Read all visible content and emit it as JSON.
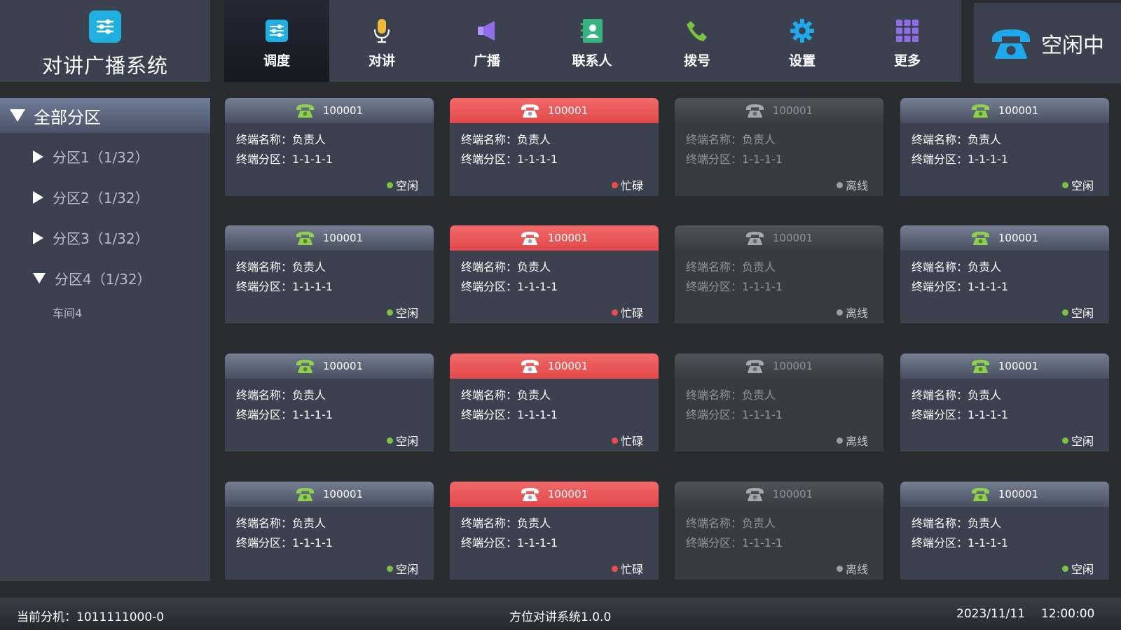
{
  "app": {
    "title": "对讲广播系统"
  },
  "nav": [
    {
      "label": "调度",
      "icon": "dispatch-icon",
      "active": true
    },
    {
      "label": "对讲",
      "icon": "microphone-icon"
    },
    {
      "label": "广播",
      "icon": "speaker-icon"
    },
    {
      "label": "联系人",
      "icon": "contacts-icon"
    },
    {
      "label": "拨号",
      "icon": "dial-phone-icon"
    },
    {
      "label": "设置",
      "icon": "gear-icon"
    },
    {
      "label": "更多",
      "icon": "grid-icon"
    }
  ],
  "status": {
    "text": "空闲中",
    "icon": "telephone-icon"
  },
  "sidebar": {
    "header": "全部分区",
    "items": [
      {
        "label": "分区1（1/32）",
        "expanded": false
      },
      {
        "label": "分区2（1/32）",
        "expanded": false
      },
      {
        "label": "分区3（1/32）",
        "expanded": false
      },
      {
        "label": "分区4（1/32）",
        "expanded": true,
        "children": [
          "车间4"
        ]
      }
    ]
  },
  "card_labels": {
    "name_prefix": "终端名称：",
    "zone_prefix": "终端分区："
  },
  "status_labels": {
    "idle": "空闲",
    "busy": "忙碌",
    "offline": "离线"
  },
  "colors": {
    "idle": "#7cc142",
    "busy": "#e24848",
    "offline": "#8f939c",
    "accent": "#1fb0e0"
  },
  "terminals": [
    {
      "id": "100001",
      "name": "负责人",
      "zone": "1-1-1-1",
      "state": "idle"
    },
    {
      "id": "100001",
      "name": "负责人",
      "zone": "1-1-1-1",
      "state": "busy"
    },
    {
      "id": "100001",
      "name": "负责人",
      "zone": "1-1-1-1",
      "state": "offline"
    },
    {
      "id": "100001",
      "name": "负责人",
      "zone": "1-1-1-1",
      "state": "idle"
    },
    {
      "id": "100001",
      "name": "负责人",
      "zone": "1-1-1-1",
      "state": "idle"
    },
    {
      "id": "100001",
      "name": "负责人",
      "zone": "1-1-1-1",
      "state": "busy"
    },
    {
      "id": "100001",
      "name": "负责人",
      "zone": "1-1-1-1",
      "state": "offline"
    },
    {
      "id": "100001",
      "name": "负责人",
      "zone": "1-1-1-1",
      "state": "idle"
    },
    {
      "id": "100001",
      "name": "负责人",
      "zone": "1-1-1-1",
      "state": "idle"
    },
    {
      "id": "100001",
      "name": "负责人",
      "zone": "1-1-1-1",
      "state": "busy"
    },
    {
      "id": "100001",
      "name": "负责人",
      "zone": "1-1-1-1",
      "state": "offline"
    },
    {
      "id": "100001",
      "name": "负责人",
      "zone": "1-1-1-1",
      "state": "idle"
    },
    {
      "id": "100001",
      "name": "负责人",
      "zone": "1-1-1-1",
      "state": "idle"
    },
    {
      "id": "100001",
      "name": "负责人",
      "zone": "1-1-1-1",
      "state": "busy"
    },
    {
      "id": "100001",
      "name": "负责人",
      "zone": "1-1-1-1",
      "state": "offline"
    },
    {
      "id": "100001",
      "name": "负责人",
      "zone": "1-1-1-1",
      "state": "idle"
    }
  ],
  "footer": {
    "current_unit": "当前分机：1011111000-0",
    "version": "方位对讲系统1.0.0",
    "date": "2023/11/11",
    "time": "12:00:00"
  }
}
